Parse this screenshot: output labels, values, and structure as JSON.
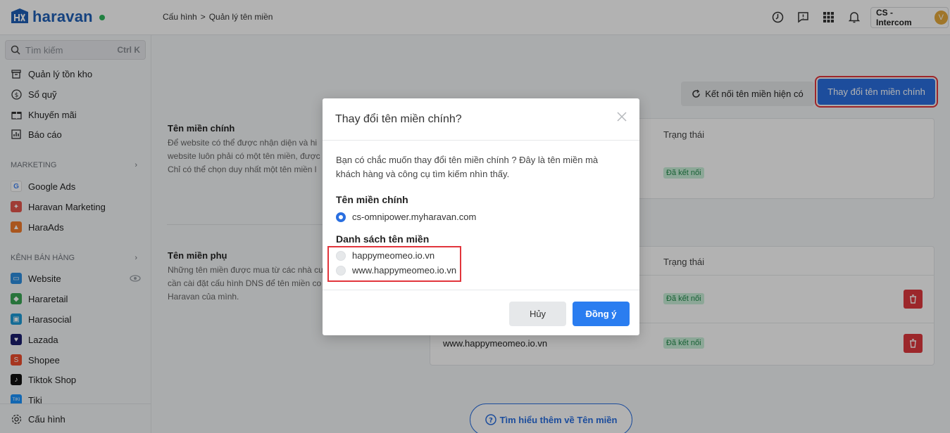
{
  "app": {
    "name": "haravan",
    "online_color": "#2eb85c"
  },
  "breadcrumb": {
    "parent": "Cấu hình",
    "separator": ">",
    "current": "Quản lý tên miền"
  },
  "topbar": {
    "icons": [
      "support-icon",
      "feedback-icon",
      "apps-grid-icon",
      "notification-bell-icon"
    ],
    "store_name": "CS - Intercom",
    "avatar_initial": "V"
  },
  "search": {
    "placeholder": "Tìm kiếm",
    "shortcut": "Ctrl K"
  },
  "sidebar": {
    "items_top": [
      {
        "label": "Quản lý tồn kho",
        "icon": "inventory-icon"
      },
      {
        "label": "Sổ quỹ",
        "icon": "cashbook-icon"
      },
      {
        "label": "Khuyến mãi",
        "icon": "promotion-icon"
      },
      {
        "label": "Báo cáo",
        "icon": "report-icon"
      }
    ],
    "marketing_header": "MARKETING",
    "marketing_items": [
      {
        "label": "Google Ads",
        "icon": "google-icon"
      },
      {
        "label": "Haravan Marketing",
        "icon": "haravan-marketing-icon"
      },
      {
        "label": "HaraAds",
        "icon": "haraads-icon"
      }
    ],
    "channels_header": "KÊNH BÁN HÀNG",
    "channel_items": [
      {
        "label": "Website",
        "icon": "website-icon"
      },
      {
        "label": "Hararetail",
        "icon": "hararetail-icon"
      },
      {
        "label": "Harasocial",
        "icon": "harasocial-icon"
      },
      {
        "label": "Lazada",
        "icon": "lazada-icon"
      },
      {
        "label": "Shopee",
        "icon": "shopee-icon"
      },
      {
        "label": "Tiktok Shop",
        "icon": "tiktok-icon"
      },
      {
        "label": "Tiki",
        "icon": "tiki-icon"
      }
    ],
    "settings_label": "Cấu hình"
  },
  "main": {
    "connect_button": "Kết nối tên miền hiện có",
    "change_button": "Thay đổi tên miền chính",
    "primary_section": {
      "title": "Tên miền chính",
      "desc_lines": [
        "Để website có thể được nhận diện và hi",
        "website luôn phải có một tên miền, được",
        "Chỉ có thể chọn duy nhất một tên miền l"
      ],
      "status_header": "Trạng thái",
      "status": "Đã kết nối"
    },
    "secondary_section": {
      "title": "Tên miền phụ",
      "desc_lines": [
        "Những tên miền được mua từ các nhà cu",
        "cần cài đặt cấu hình DNS để tên miền co",
        "Haravan của mình."
      ],
      "status_header": "Trạng thái",
      "rows": [
        {
          "domain": "",
          "status": "Đã kết nối"
        },
        {
          "domain": "www.happymeomeo.io.vn",
          "status": "Đã kết nối"
        }
      ]
    },
    "learn_more": "Tìm hiểu thêm về Tên miền"
  },
  "modal": {
    "title": "Thay đổi tên miền chính?",
    "message": "Bạn có chắc muốn thay đổi tên miền chính ? Đây là tên miền mà khách hàng và công cụ tìm kiếm nhìn thấy.",
    "primary_label": "Tên miền chính",
    "primary_domain": "cs-omnipower.myharavan.com",
    "list_label": "Danh sách tên miền",
    "domains": [
      "happymeomeo.io.vn",
      "www.happymeomeo.io.vn"
    ],
    "cancel": "Hủy",
    "confirm": "Đồng ý"
  }
}
